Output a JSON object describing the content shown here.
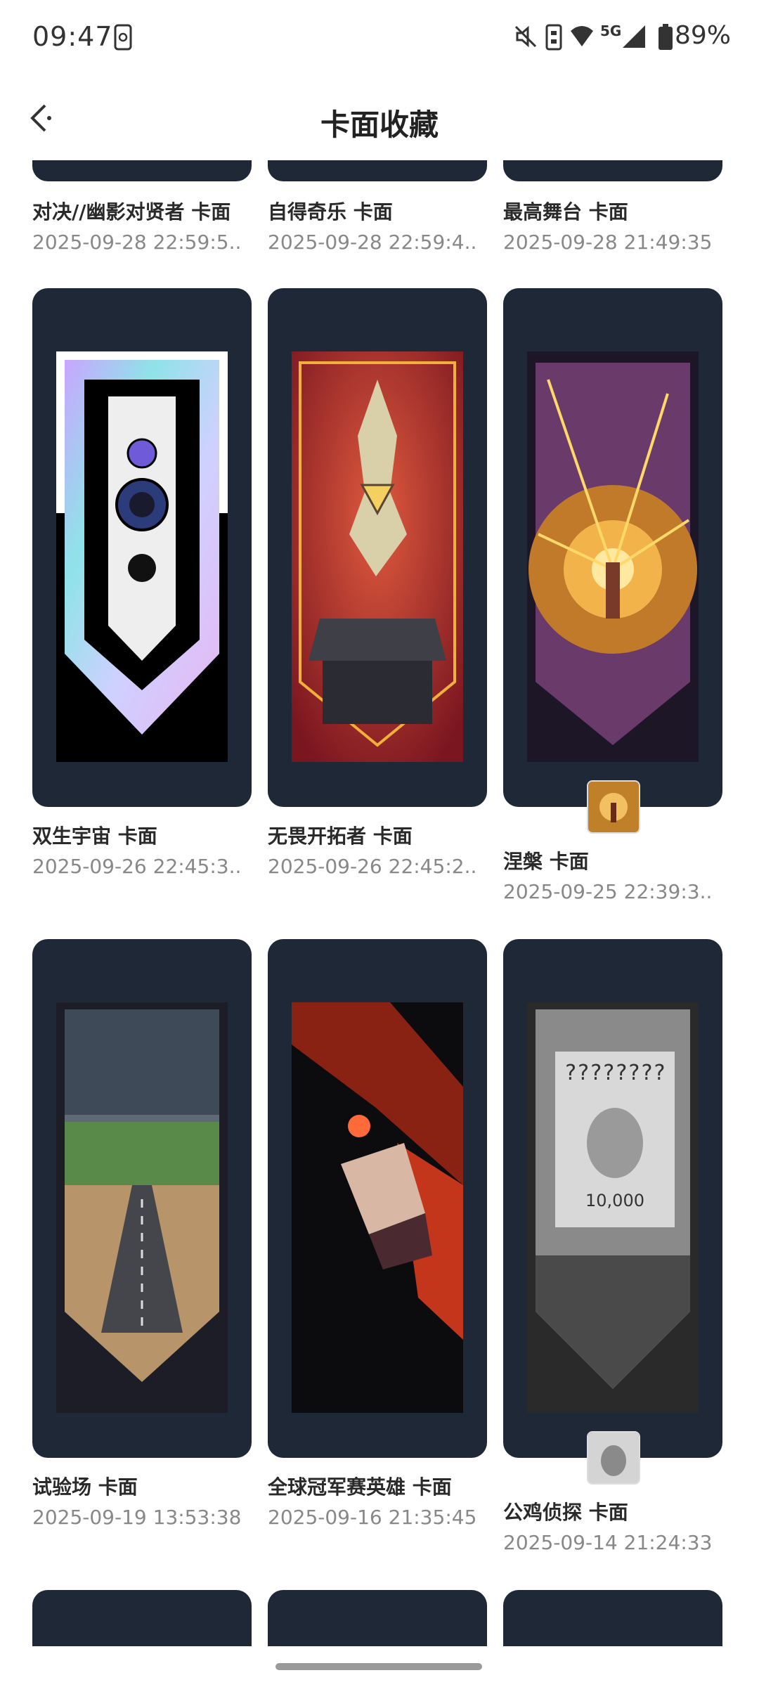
{
  "status": {
    "time": "09:47",
    "battery": "89%",
    "network": "5G"
  },
  "header": {
    "title": "卡面收藏",
    "back_icon": "back-arrow-icon"
  },
  "top_row": [
    {
      "name": "对决//幽影对贤者 卡面",
      "date": "2025-09-28 22:59:5..."
    },
    {
      "name": "自得奇乐 卡面",
      "date": "2025-09-28 22:59:4..."
    },
    {
      "name": "最高舞台 卡面",
      "date": "2025-09-28 21:49:35..."
    }
  ],
  "row2": [
    {
      "name": "双生宇宙 卡面",
      "date": "2025-09-26 22:45:3..."
    },
    {
      "name": "无畏开拓者 卡面",
      "date": "2025-09-26 22:45:2..."
    },
    {
      "name": "涅槃 卡面",
      "date": "2025-09-25 22:39:3..."
    }
  ],
  "row3": [
    {
      "name": "试验场 卡面",
      "date": "2025-09-19 13:53:38..."
    },
    {
      "name": "全球冠军赛英雄 卡面",
      "date": "2025-09-16 21:35:45..."
    },
    {
      "name": "公鸡侦探 卡面",
      "date": "2025-09-14 21:24:33..."
    }
  ],
  "poster": {
    "title": "????????",
    "reward": "10,000"
  },
  "colors": {
    "card_bg": "#1e2836",
    "text_primary": "#2a2a2a",
    "text_secondary": "#888888"
  }
}
